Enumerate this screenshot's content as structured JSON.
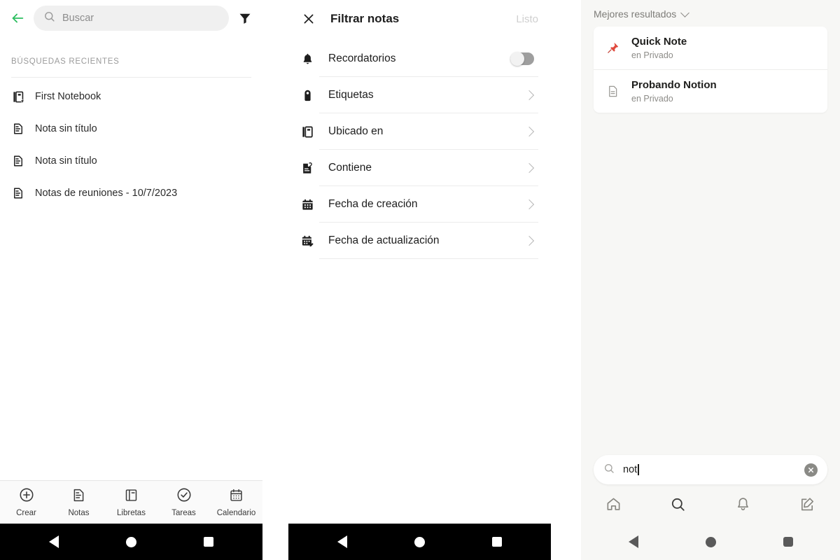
{
  "panel1": {
    "name": "evernote-search",
    "topbar": {
      "back_icon": "arrow-left-icon",
      "back_color": "#2dbe60",
      "search_placeholder": "Buscar",
      "search_icon": "search-icon",
      "filter_icon": "funnel-icon"
    },
    "section_title": "BÚSQUEDAS RECIENTES",
    "recent_searches": [
      {
        "label": "First Notebook",
        "icon": "notebook-star-icon"
      },
      {
        "label": "Nota sin título",
        "icon": "note-icon"
      },
      {
        "label": "Nota sin título",
        "icon": "note-icon"
      },
      {
        "label": "Notas de reuniones - 10/7/2023",
        "icon": "note-icon"
      }
    ],
    "bottom_nav": [
      {
        "label": "Crear",
        "icon": "plus-circle-icon"
      },
      {
        "label": "Notas",
        "icon": "note-icon"
      },
      {
        "label": "Libretas",
        "icon": "notebook-icon"
      },
      {
        "label": "Tareas",
        "icon": "check-circle-icon"
      },
      {
        "label": "Calendario",
        "icon": "calendar-icon"
      }
    ]
  },
  "panel2": {
    "name": "filter-notes-sheet",
    "header": {
      "close_icon": "close-icon",
      "title": "Filtrar notas",
      "done_label": "Listo",
      "done_color": "#cfcfcf"
    },
    "filters": [
      {
        "label": "Recordatorios",
        "icon": "bell-icon",
        "control": "toggle",
        "toggle_on": false
      },
      {
        "label": "Etiquetas",
        "icon": "tag-icon",
        "control": "chevron"
      },
      {
        "label": "Ubicado en",
        "icon": "notebook-icon",
        "control": "chevron"
      },
      {
        "label": "Contiene",
        "icon": "note-attachment-icon",
        "control": "chevron"
      },
      {
        "label": "Fecha de creación",
        "icon": "calendar-icon",
        "control": "chevron"
      },
      {
        "label": "Fecha de actualización",
        "icon": "calendar-edit-icon",
        "control": "chevron"
      }
    ]
  },
  "panel3": {
    "name": "notion-search",
    "header": {
      "label": "Mejores resultados",
      "icon": "chevron-down-icon"
    },
    "results": [
      {
        "title": "Quick Note",
        "subtitle": "en Privado",
        "icon": "pushpin-icon",
        "glyph": "📌"
      },
      {
        "title": "Probando Notion",
        "subtitle": "en Privado",
        "icon": "document-icon",
        "glyph": ""
      }
    ],
    "search": {
      "value": "not",
      "search_icon": "search-icon",
      "clear_icon": "clear-circle-icon"
    },
    "bottom_nav": [
      {
        "icon": "home-icon"
      },
      {
        "icon": "search-icon"
      },
      {
        "icon": "bell-icon"
      },
      {
        "icon": "compose-icon"
      }
    ]
  },
  "system_bar": {
    "back": "triangle-back-icon",
    "home": "circle-home-icon",
    "recents": "square-recents-icon"
  }
}
